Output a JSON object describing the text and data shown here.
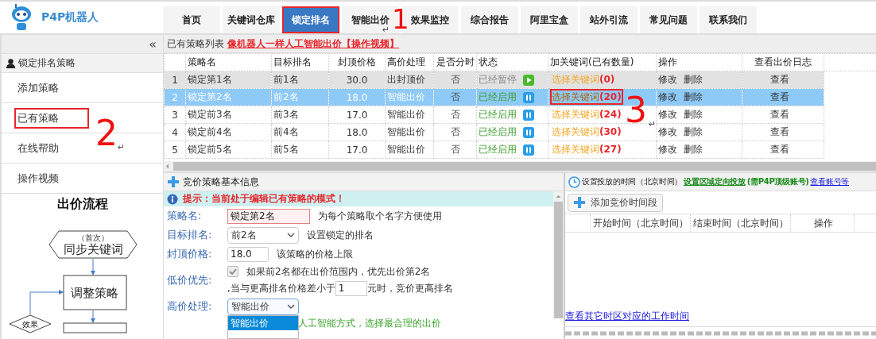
{
  "logo": {
    "text": "P4P机器人"
  },
  "nav_tabs": [
    {
      "label": "首页",
      "selected": false,
      "annotated": false
    },
    {
      "label": "关键词仓库",
      "selected": false,
      "annotated": false
    },
    {
      "label": "锁定排名",
      "selected": true,
      "annotated": true
    },
    {
      "label": "智能出价",
      "selected": false,
      "annotated": false
    },
    {
      "label": "效果监控",
      "selected": false,
      "annotated": false
    },
    {
      "label": "综合报告",
      "selected": false,
      "annotated": false
    },
    {
      "label": "阿里宝盒",
      "selected": false,
      "annotated": false
    },
    {
      "label": "站外引流",
      "selected": false,
      "annotated": false
    },
    {
      "label": "常见问题",
      "selected": false,
      "annotated": false
    },
    {
      "label": "联系我们",
      "selected": false,
      "annotated": false
    }
  ],
  "sidebar": {
    "collapse": "«",
    "section_title": "锁定排名策略",
    "items": [
      {
        "label": "添加策略",
        "selected": false,
        "annotated": false
      },
      {
        "label": "已有策略",
        "selected": false,
        "annotated": true
      },
      {
        "label": "在线帮助",
        "selected": false,
        "annotated": false
      },
      {
        "label": "操作视频",
        "selected": false,
        "annotated": false
      }
    ],
    "flow_title": "出价流程",
    "flow_nodes": [
      {
        "kind": "hexagon",
        "note": "（首次）",
        "label": "同步关键词"
      },
      {
        "kind": "box",
        "label": "调整策略"
      },
      {
        "kind": "box"
      },
      {
        "kind": "diamond",
        "label": "效果"
      }
    ]
  },
  "strategy_list": {
    "title": "已有策略列表",
    "link": "像机器人一样人工智能出价【操作视频】",
    "columns": [
      "",
      "策略名",
      "目标排名",
      "封顶价格",
      "高价处理",
      "是否分时",
      "状态",
      "加关键词(已有数量)",
      "操作",
      "查看出价日志",
      ""
    ],
    "rows": [
      {
        "index": "1",
        "name": "锁定第1名",
        "target": "前1名",
        "cap_price": "30.0",
        "high_price": "出封顶价",
        "timeshare": "否",
        "status": "已经暂停",
        "paused": true,
        "keyword_link": "选择关键词",
        "keyword_count": "(0)",
        "keyword_annotated": false,
        "actions": [
          "修改",
          "删除"
        ],
        "log": "查看",
        "selected": false
      },
      {
        "index": "2",
        "name": "锁定第2名",
        "target": "前2名",
        "cap_price": "18.0",
        "high_price": "智能出价",
        "timeshare": "否",
        "status": "已经启用",
        "paused": false,
        "keyword_link": "选择关键词",
        "keyword_count": "(20)",
        "keyword_annotated": true,
        "actions": [
          "修改",
          "删除"
        ],
        "log": "查看",
        "selected": true
      },
      {
        "index": "3",
        "name": "锁定前3名",
        "target": "前3名",
        "cap_price": "17.0",
        "high_price": "智能出价",
        "timeshare": "否",
        "status": "已经启用",
        "paused": false,
        "keyword_link": "选择关键词",
        "keyword_count": "(24)",
        "keyword_annotated": false,
        "actions": [
          "修改",
          "删除"
        ],
        "log": "查看",
        "selected": false
      },
      {
        "index": "4",
        "name": "锁定前4名",
        "target": "前4名",
        "cap_price": "18.0",
        "high_price": "智能出价",
        "timeshare": "否",
        "status": "已经启用",
        "paused": false,
        "keyword_link": "选择关键词",
        "keyword_count": "(30)",
        "keyword_annotated": false,
        "actions": [
          "修改",
          "删除"
        ],
        "log": "查看",
        "selected": false
      },
      {
        "index": "5",
        "name": "锁定前5名",
        "target": "前5名",
        "cap_price": "17.0",
        "high_price": "智能出价",
        "timeshare": "否",
        "status": "已经启用",
        "paused": false,
        "keyword_link": "选择关键词",
        "keyword_count": "(27)",
        "keyword_annotated": false,
        "actions": [
          "修改",
          "删除"
        ],
        "log": "查看",
        "selected": false
      }
    ]
  },
  "strategy_form": {
    "title": "竞价策略基本信息",
    "notice": "提示：当前处于编辑已有策略的模式！",
    "name": {
      "label": "策略名:",
      "value": "锁定第2名",
      "hint": "为每个策略取个名字方便使用"
    },
    "target": {
      "label": "目标排名:",
      "value": "前2名",
      "hint": "设置锁定的排名"
    },
    "cap": {
      "label": "封顶价格:",
      "value": "18.0",
      "hint": "该策略的价格上限"
    },
    "low_price": {
      "label": "低价优先:",
      "checked": true,
      "disabled": true,
      "line1": "如果前2名都在出价范围内，优先出价第2名",
      "line2_before": ",当与更高排名价格差小于",
      "value": "1",
      "line2_after": "元时，竞价更高排名"
    },
    "high_price": {
      "label": "高价处理:",
      "value": "智能出价",
      "expanded": true,
      "options": [
        {
          "label": "智能出价",
          "selected": true
        }
      ],
      "hint": "人工智能方式，选择最合理的出价"
    }
  },
  "timing": {
    "title": "设置投放的时间（北京时间）",
    "region_link": "设置区域定向投放",
    "region_note": "(需P4P顶级账号)",
    "account_link": "查看账号等",
    "add_button": "添加竞价时间段",
    "columns": [
      "",
      "开始时间（北京时间）",
      "结束时间（北京时间）",
      "操作",
      ""
    ],
    "timezone_link": "查看其它时区对应的工作时间"
  },
  "annotations": [
    {
      "number": "1",
      "mark": "↵"
    },
    {
      "number": "2",
      "mark": "↵"
    },
    {
      "number": "3",
      "mark": "↵"
    }
  ]
}
